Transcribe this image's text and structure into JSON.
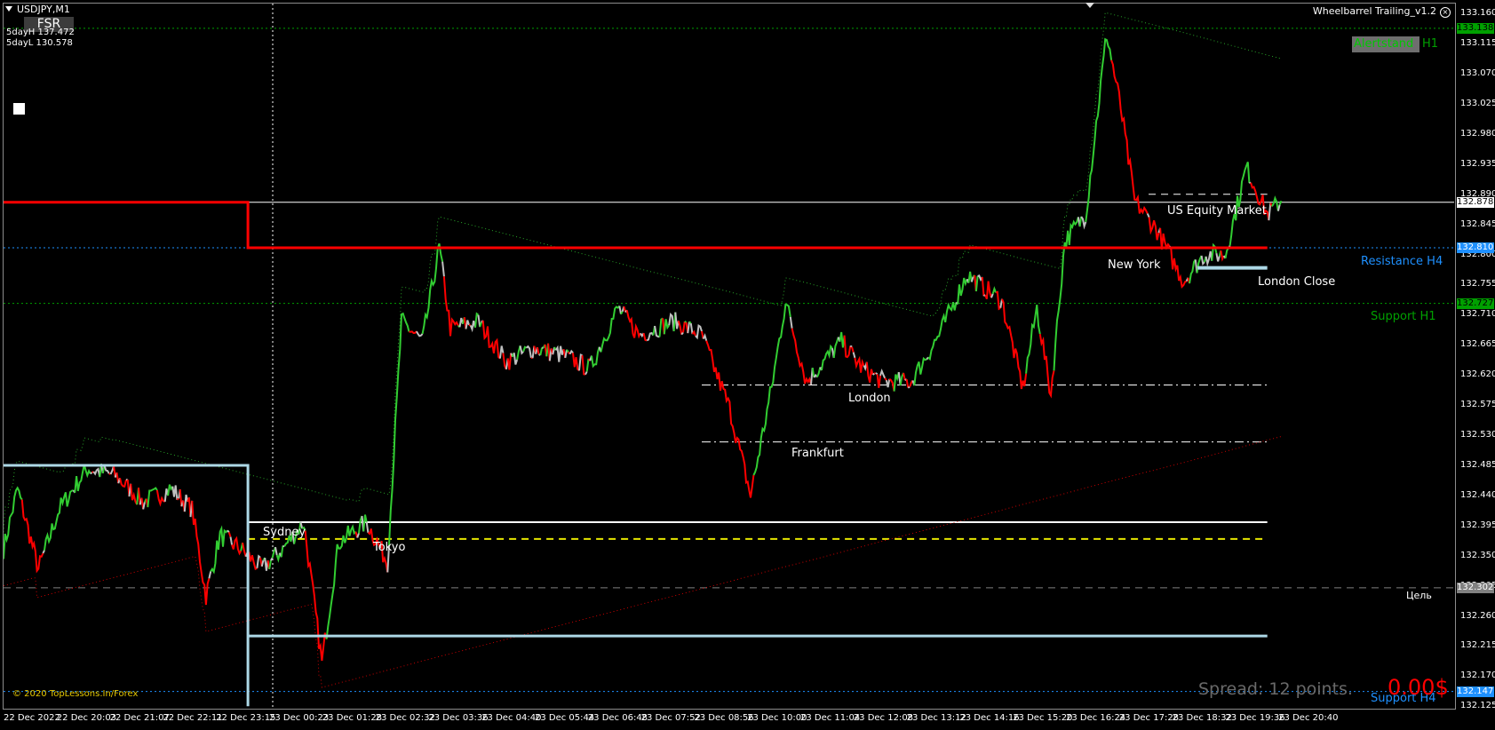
{
  "symbol": "USDJPY,M1",
  "fsr_button": "FSR",
  "info": [
    "5dayH 137.472",
    "5dayL 130.578"
  ],
  "indicator": {
    "name": "Wheelbarrel Trailing_v1.2",
    "close_icon": "close-circle-icon"
  },
  "sessions": {
    "sydney": "Sydney",
    "tokyo": "Tokyo",
    "frankfurt": "Frankfurt",
    "london": "London",
    "new_york": "New York",
    "us_equity": "US Equity Market",
    "london_close": "London Close"
  },
  "levels": {
    "alert_box": "Alertstand",
    "alert_suffix": "H1",
    "resistance_h4": "Resistance H4",
    "support_h1": "Support H1",
    "support_h4": "Support H4",
    "target": "Цель"
  },
  "copyright": "© 2020 TopLessons.In/Forex",
  "spread": "Spread: 12 points.",
  "profit": "0.00$",
  "price_axis": {
    "ticks": [
      "133.160",
      "133.115",
      "133.070",
      "133.025",
      "132.980",
      "132.935",
      "132.890",
      "132.845",
      "132.800",
      "132.755",
      "132.710",
      "132.665",
      "132.620",
      "132.575",
      "132.530",
      "132.485",
      "132.440",
      "132.395",
      "132.350",
      "132.305",
      "132.260",
      "132.215",
      "132.170",
      "132.125"
    ],
    "tick_values": [
      133.16,
      133.115,
      133.07,
      133.025,
      132.98,
      132.935,
      132.89,
      132.845,
      132.8,
      132.755,
      132.71,
      132.665,
      132.62,
      132.575,
      132.53,
      132.485,
      132.44,
      132.395,
      132.35,
      132.305,
      132.26,
      132.215,
      132.17,
      132.125
    ],
    "labels": [
      {
        "text": "133.138",
        "value": 133.138,
        "bg": "#00a000",
        "fg": "#000000"
      },
      {
        "text": "132.878",
        "value": 132.878,
        "bg": "#ffffff",
        "fg": "#000000"
      },
      {
        "text": "132.810",
        "value": 132.81,
        "bg": "#1e90ff",
        "fg": "#ffffff"
      },
      {
        "text": "132.727",
        "value": 132.727,
        "bg": "#00a000",
        "fg": "#000000"
      },
      {
        "text": "132.302",
        "value": 132.302,
        "bg": "#808080",
        "fg": "#ffffff"
      },
      {
        "text": "132.147",
        "value": 132.147,
        "bg": "#1e90ff",
        "fg": "#ffffff"
      }
    ]
  },
  "time_axis": [
    "22 Dec 2022",
    "22 Dec 20:03",
    "22 Dec 21:07",
    "22 Dec 22:11",
    "22 Dec 23:15",
    "23 Dec 00:23",
    "23 Dec 01:28",
    "23 Dec 02:32",
    "23 Dec 03:36",
    "23 Dec 04:40",
    "23 Dec 05:44",
    "23 Dec 06:48",
    "23 Dec 07:52",
    "23 Dec 08:56",
    "23 Dec 10:00",
    "23 Dec 11:04",
    "23 Dec 12:08",
    "23 Dec 13:12",
    "23 Dec 14:16",
    "23 Dec 15:20",
    "23 Dec 16:24",
    "23 Dec 17:28",
    "23 Dec 18:32",
    "23 Dec 19:36",
    "23 Dec 20:40"
  ],
  "colors": {
    "up": "#32cd32",
    "down": "#ff0000",
    "neutral": "#c0c0c0",
    "resistance": "#ff0000",
    "support": "#add8e6",
    "grid_green": "#00a000",
    "grid_blue": "#1e90ff",
    "yellow": "#e6e600"
  },
  "chart_data": {
    "type": "line",
    "symbol": "USDJPY",
    "timeframe": "M1",
    "ylim": [
      132.12,
      133.175
    ],
    "price_path": [
      {
        "t": 0,
        "v": 132.36
      },
      {
        "t": 0.01,
        "v": 132.45
      },
      {
        "t": 0.025,
        "v": 132.33
      },
      {
        "t": 0.04,
        "v": 132.42
      },
      {
        "t": 0.06,
        "v": 132.48
      },
      {
        "t": 0.08,
        "v": 132.47
      },
      {
        "t": 0.1,
        "v": 132.43
      },
      {
        "t": 0.12,
        "v": 132.45
      },
      {
        "t": 0.135,
        "v": 132.42
      },
      {
        "t": 0.145,
        "v": 132.29
      },
      {
        "t": 0.155,
        "v": 132.38
      },
      {
        "t": 0.17,
        "v": 132.36
      },
      {
        "t": 0.185,
        "v": 132.33
      },
      {
        "t": 0.2,
        "v": 132.36
      },
      {
        "t": 0.215,
        "v": 132.4
      },
      {
        "t": 0.228,
        "v": 132.19
      },
      {
        "t": 0.24,
        "v": 132.37
      },
      {
        "t": 0.26,
        "v": 132.4
      },
      {
        "t": 0.275,
        "v": 132.34
      },
      {
        "t": 0.285,
        "v": 132.7
      },
      {
        "t": 0.3,
        "v": 132.67
      },
      {
        "t": 0.312,
        "v": 132.81
      },
      {
        "t": 0.32,
        "v": 132.69
      },
      {
        "t": 0.34,
        "v": 132.7
      },
      {
        "t": 0.36,
        "v": 132.64
      },
      {
        "t": 0.38,
        "v": 132.66
      },
      {
        "t": 0.4,
        "v": 132.65
      },
      {
        "t": 0.42,
        "v": 132.63
      },
      {
        "t": 0.44,
        "v": 132.72
      },
      {
        "t": 0.455,
        "v": 132.68
      },
      {
        "t": 0.48,
        "v": 132.7
      },
      {
        "t": 0.5,
        "v": 132.68
      },
      {
        "t": 0.52,
        "v": 132.57
      },
      {
        "t": 0.535,
        "v": 132.44
      },
      {
        "t": 0.55,
        "v": 132.6
      },
      {
        "t": 0.56,
        "v": 132.73
      },
      {
        "t": 0.575,
        "v": 132.61
      },
      {
        "t": 0.6,
        "v": 132.67
      },
      {
        "t": 0.615,
        "v": 132.63
      },
      {
        "t": 0.63,
        "v": 132.61
      },
      {
        "t": 0.65,
        "v": 132.61
      },
      {
        "t": 0.67,
        "v": 132.68
      },
      {
        "t": 0.69,
        "v": 132.77
      },
      {
        "t": 0.715,
        "v": 132.73
      },
      {
        "t": 0.73,
        "v": 132.6
      },
      {
        "t": 0.74,
        "v": 132.72
      },
      {
        "t": 0.75,
        "v": 132.59
      },
      {
        "t": 0.76,
        "v": 132.82
      },
      {
        "t": 0.775,
        "v": 132.86
      },
      {
        "t": 0.79,
        "v": 133.13
      },
      {
        "t": 0.8,
        "v": 133.02
      },
      {
        "t": 0.81,
        "v": 132.88
      },
      {
        "t": 0.825,
        "v": 132.84
      },
      {
        "t": 0.845,
        "v": 132.76
      },
      {
        "t": 0.86,
        "v": 132.8
      },
      {
        "t": 0.875,
        "v": 132.8
      },
      {
        "t": 0.89,
        "v": 132.93
      },
      {
        "t": 0.905,
        "v": 132.86
      },
      {
        "t": 0.915,
        "v": 132.88
      }
    ],
    "resistance_line": [
      {
        "t": 0,
        "v": 132.878
      },
      {
        "t": 0.175,
        "v": 132.878
      },
      {
        "t": 0.175,
        "v": 132.81
      },
      {
        "t": 0.905,
        "v": 132.81
      }
    ],
    "support_line": [
      {
        "t": 0,
        "v": 132.485
      },
      {
        "t": 0.175,
        "v": 132.485
      },
      {
        "t": 0.175,
        "v": 132.125
      },
      {
        "t": 0.175,
        "v": 132.23
      },
      {
        "t": 0.905,
        "v": 132.23
      }
    ],
    "horizontal_levels": [
      {
        "name": "Alertstand H1",
        "value": 133.138,
        "style": "dotted",
        "color": "#00a000"
      },
      {
        "name": "Current price",
        "value": 132.878,
        "style": "solid",
        "color": "#ffffff"
      },
      {
        "name": "Resistance H4",
        "value": 132.81,
        "style": "dotted",
        "color": "#1e90ff"
      },
      {
        "name": "Support H1",
        "value": 132.727,
        "style": "dotted",
        "color": "#00a000"
      },
      {
        "name": "Цель",
        "value": 132.302,
        "style": "dashed",
        "color": "#808080"
      },
      {
        "name": "Support H4",
        "value": 132.147,
        "style": "dotted",
        "color": "#1e90ff"
      },
      {
        "name": "Level 132.400",
        "value": 132.4,
        "style": "solid",
        "color": "#ffffff"
      },
      {
        "name": "Level 132.375",
        "value": 132.375,
        "style": "dashed",
        "color": "#e6e600"
      },
      {
        "name": "Level 132.605",
        "value": 132.605,
        "style": "dashdot",
        "color": "#ffffff"
      },
      {
        "name": "Level 132.520",
        "value": 132.52,
        "style": "dashdot",
        "color": "#ffffff"
      },
      {
        "name": "Level 132.890",
        "value": 132.89,
        "style": "dashed",
        "color": "#ffffff"
      }
    ],
    "grid": false
  }
}
